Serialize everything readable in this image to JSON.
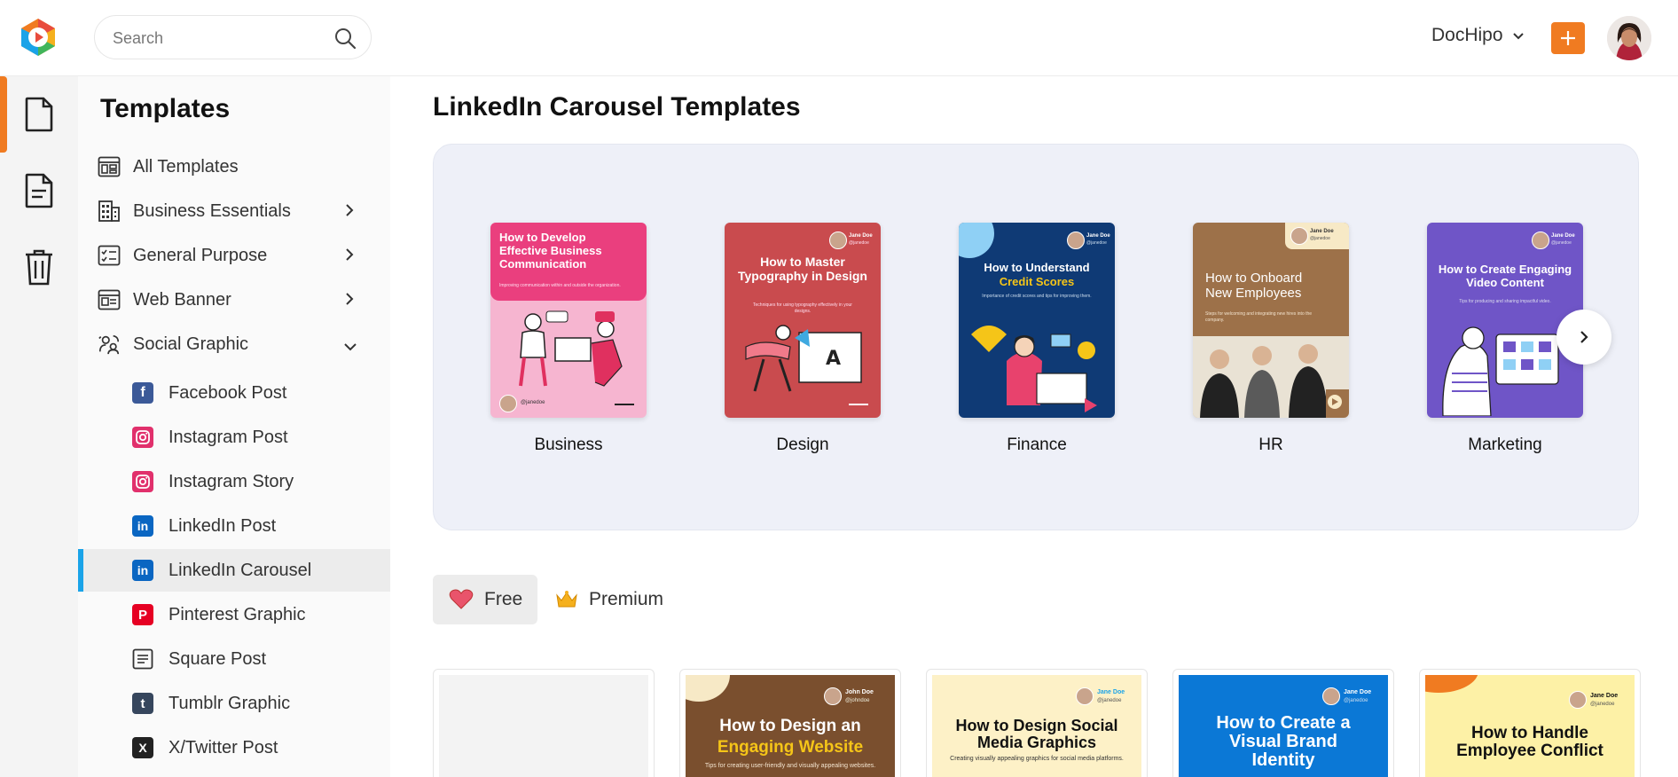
{
  "header": {
    "search_placeholder": "Search",
    "account_name": "DocHipo"
  },
  "sidebar": {
    "title": "Templates",
    "items": [
      {
        "label": "All Templates"
      },
      {
        "label": "Business Essentials"
      },
      {
        "label": "General Purpose"
      },
      {
        "label": "Web Banner"
      },
      {
        "label": "Social Graphic"
      }
    ],
    "sub_items": [
      {
        "label": "Facebook Post"
      },
      {
        "label": "Instagram Post"
      },
      {
        "label": "Instagram Story"
      },
      {
        "label": "LinkedIn Post"
      },
      {
        "label": "LinkedIn Carousel"
      },
      {
        "label": "Pinterest Graphic"
      },
      {
        "label": "Square Post"
      },
      {
        "label": "Tumblr Graphic"
      },
      {
        "label": "X/Twitter Post"
      }
    ]
  },
  "main": {
    "title": "LinkedIn Carousel Templates",
    "categories": [
      {
        "name": "Business",
        "thumb_title": "How to Develop Effective Business Communication",
        "thumb_sub": "Improving communication within and outside the organization.",
        "author": "@janedoe"
      },
      {
        "name": "Design",
        "thumb_title": "How to Master Typography in Design",
        "thumb_sub": "Techniques for using typography effectively in your designs.",
        "author": "Jane Doe",
        "handle": "@janedoe"
      },
      {
        "name": "Finance",
        "thumb_title": "How to Understand",
        "thumb_title_accent": "Credit Scores",
        "thumb_sub": "Importance of credit scores and tips for improving them.",
        "author": "Jane Doe",
        "handle": "@janedoe"
      },
      {
        "name": "HR",
        "thumb_title": "How to Onboard New Employees",
        "thumb_sub": "Steps for welcoming and integrating new hires into the company.",
        "author": "Jane Doe",
        "handle": "@janedoe"
      },
      {
        "name": "Marketing",
        "thumb_title": "How to Create Engaging Video Content",
        "thumb_sub": "Tips for producing and sharing impactful video.",
        "author": "Jane Doe",
        "handle": "@janedoe"
      }
    ],
    "filters": {
      "free": "Free",
      "premium": "Premium"
    },
    "cards": [
      {
        "title": ""
      },
      {
        "title": "How to Design an",
        "accent": "Engaging Website",
        "sub": "Tips for creating user-friendly and visually appealing websites.",
        "author": "John Doe",
        "handle": "@johndoe"
      },
      {
        "title": "How to Design Social Media Graphics",
        "sub": "Creating visually appealing graphics for social media platforms.",
        "author": "Jane Doe",
        "handle": "@janedoe"
      },
      {
        "title": "How to Create a Visual Brand Identity",
        "author": "Jane Doe",
        "handle": "@janedoe"
      },
      {
        "title": "How to Handle Employee Conflict",
        "author": "Jane Doe",
        "handle": "@janedoe"
      }
    ]
  },
  "colors": {
    "accent": "#f07b21",
    "active_indicator": "#1aa3e8",
    "hero_bg": "#eef0f8"
  }
}
